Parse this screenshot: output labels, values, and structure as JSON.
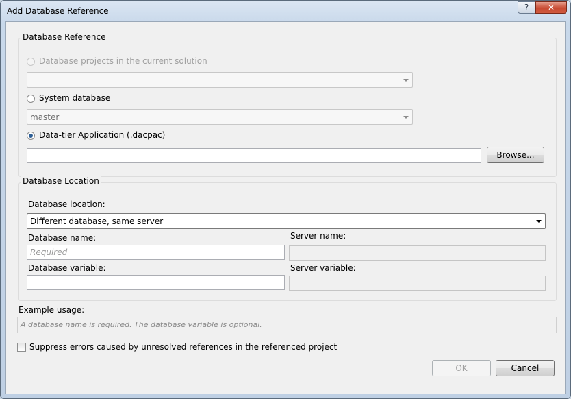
{
  "window": {
    "title": "Add Database Reference",
    "help_glyph": "?",
    "close_glyph": "✕"
  },
  "database_reference": {
    "legend": "Database Reference",
    "option_projects": "Database projects in the current solution",
    "projects_value": "",
    "option_system": "System database",
    "system_value": "master",
    "option_dacpac": "Data-tier Application (.dacpac)",
    "dacpac_path": "",
    "browse_label": "Browse..."
  },
  "database_location": {
    "legend": "Database Location",
    "location_label": "Database location:",
    "location_value": "Different database, same server",
    "db_name_label": "Database name:",
    "db_name_placeholder": "Required",
    "db_name_value": "",
    "server_name_label": "Server name:",
    "server_name_value": "",
    "db_variable_label": "Database variable:",
    "db_variable_value": "",
    "server_variable_label": "Server variable:",
    "server_variable_value": ""
  },
  "example": {
    "label": "Example usage:",
    "text": "A database name is required.  The database variable is optional."
  },
  "suppress_label": "Suppress errors caused by unresolved references in the referenced project",
  "buttons": {
    "ok": "OK",
    "cancel": "Cancel"
  },
  "selection": {
    "selected_option": "dacpac",
    "suppress_checked": false
  }
}
